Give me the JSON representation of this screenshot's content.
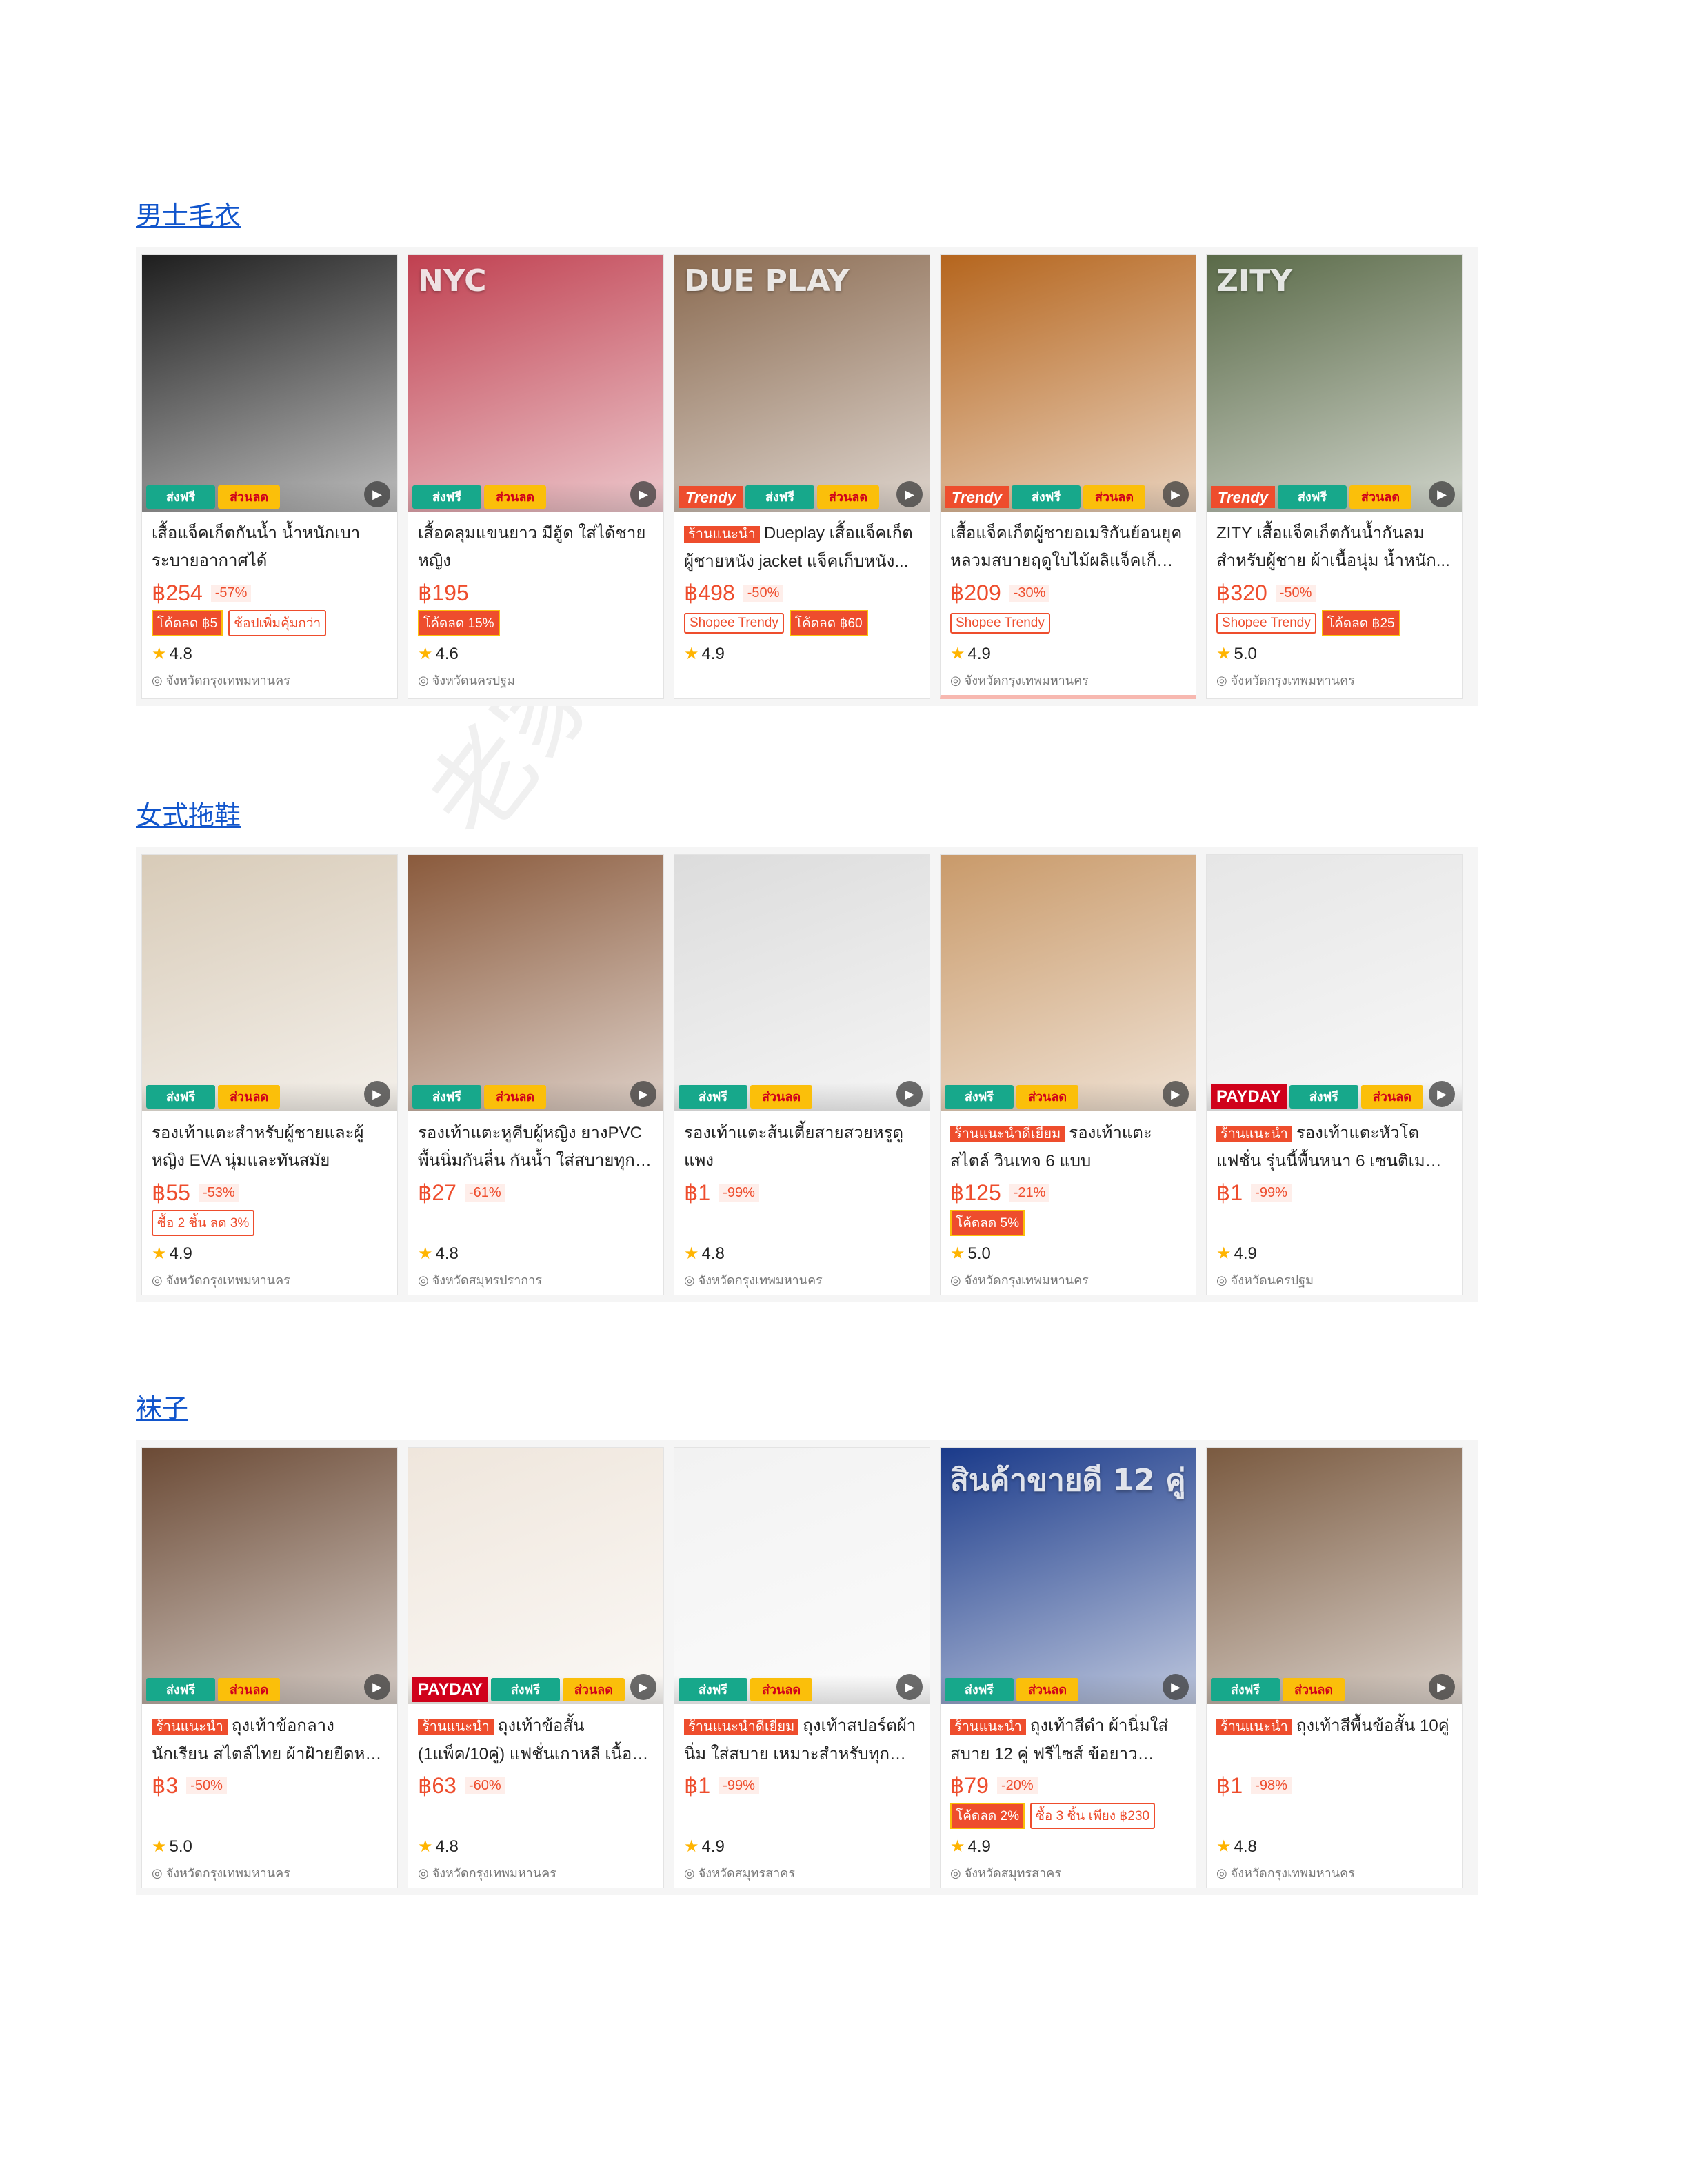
{
  "watermark": "老家出品",
  "sections": [
    {
      "title": "男士毛衣",
      "products": [
        {
          "image_text": "",
          "image_bg": "#1e1e1e",
          "top_badge": "",
          "title_tag": "",
          "title": "เสื้อแจ็คเก็ตกันน้ำ น้ำหนักเบา ระบายอากาศได้",
          "price": "฿254",
          "discount": "-57%",
          "promos": [
            {
              "text": "โค้ดลด ฿5",
              "style": "fill"
            },
            {
              "text": "ช้อปเพิ่มคุ้มกว่า",
              "style": "out"
            }
          ],
          "rating": "4.8",
          "location": "จังหวัดกรุงเทพมหานคร"
        },
        {
          "image_text": "NYC",
          "image_bg": "#c04050",
          "top_badge": "",
          "title_tag": "",
          "title": "เสื้อคลุมแขนยาว มีฮู้ด ใส่ได้ชาย หญิง",
          "price": "฿195",
          "discount": "",
          "promos": [
            {
              "text": "โค้ดลด 15%",
              "style": "fill"
            }
          ],
          "rating": "4.6",
          "location": "จังหวัดนครปฐม"
        },
        {
          "image_text": "DUE PLAY",
          "image_bg": "#8a6a50",
          "top_badge": "Trendy",
          "title_tag": "ร้านแนะนำ",
          "title": "Dueplay เสื้อแจ็คเก็ต ผู้ชายหนัง jacket แจ็คเก็บหนัง...",
          "price": "฿498",
          "discount": "-50%",
          "promos": [
            {
              "text": "Shopee Trendy",
              "style": "out"
            },
            {
              "text": "โค้ดลด ฿60",
              "style": "fill"
            }
          ],
          "rating": "4.9",
          "location": ""
        },
        {
          "image_text": "",
          "image_bg": "#b5651d",
          "top_badge": "Trendy",
          "title_tag": "",
          "title": "เสื้อแจ็คเก็ตผู้ชายอเมริกันย้อนยุค หลวมสบายฤดูใบไม้ผลิแจ็คเก็ตกันลม...",
          "price": "฿209",
          "discount": "-30%",
          "promos": [
            {
              "text": "Shopee Trendy",
              "style": "out"
            }
          ],
          "rating": "4.9",
          "location": "จังหวัดกรุงเทพมหานคร"
        },
        {
          "image_text": "ZITY",
          "image_bg": "#5a6a48",
          "top_badge": "Trendy",
          "title_tag": "",
          "title": "ZITY เสื้อแจ็คเก็ตกันน้ำกันลม สำหรับผู้ชาย ผ้าเนื้อนุ่ม น้ำหนัก...",
          "price": "฿320",
          "discount": "-50%",
          "promos": [
            {
              "text": "Shopee Trendy",
              "style": "out"
            },
            {
              "text": "โค้ดลด ฿25",
              "style": "fill"
            }
          ],
          "rating": "5.0",
          "location": "จังหวัดกรุงเทพมหานคร"
        }
      ]
    },
    {
      "title": "女式拖鞋",
      "products": [
        {
          "image_text": "",
          "image_bg": "#d8cbb8",
          "top_badge": "",
          "title_tag": "",
          "title": "รองเท้าแตะสำหรับผู้ชายและผู้หญิง EVA นุ่มและทันสมัย",
          "price": "฿55",
          "discount": "-53%",
          "promos": [
            {
              "text": "ซื้อ 2 ชิ้น ลด 3%",
              "style": "out"
            }
          ],
          "rating": "4.9",
          "location": "จังหวัดกรุงเทพมหานคร"
        },
        {
          "image_text": "",
          "image_bg": "#8a5a3c",
          "top_badge": "",
          "title_tag": "",
          "title": "รองเท้าแตะหูคีบผู้หญิง ยางPVC พื้นนิ่มกันลื่น กันน้ำ ใส่สบายทุกวั...",
          "price": "฿27",
          "discount": "-61%",
          "promos": [],
          "rating": "4.8",
          "location": "จังหวัดสมุทรปราการ"
        },
        {
          "image_text": "",
          "image_bg": "#dcdcdc",
          "top_badge": "",
          "title_tag": "",
          "title": "รองเท้าแตะส้นเตี้ยสายสวยหรูดูแพง",
          "price": "฿1",
          "discount": "-99%",
          "promos": [],
          "rating": "4.8",
          "location": "จังหวัดกรุงเทพมหานคร"
        },
        {
          "image_text": "",
          "image_bg": "#c99a6a",
          "top_badge": "",
          "title_tag": "ร้านแนะนำดีเยี่ยม",
          "title": "รองเท้าแตะสไตล์ วินเทจ 6 แบบ",
          "price": "฿125",
          "discount": "-21%",
          "promos": [
            {
              "text": "โค้ดลด 5%",
              "style": "fill"
            }
          ],
          "rating": "5.0",
          "location": "จังหวัดกรุงเทพมหานคร"
        },
        {
          "image_text": "",
          "image_bg": "#e6e6e6",
          "top_badge": "PAYDAY",
          "title_tag": "ร้านแนะนำ",
          "title": "รองเท้าแตะหัวโตแฟชั่น รุ่นนี้พื้นหนา 6 เซนติเมตร สูงปรี๊ด...",
          "price": "฿1",
          "discount": "-99%",
          "promos": [],
          "rating": "4.9",
          "location": "จังหวัดนครปฐม"
        }
      ]
    },
    {
      "title": "袜子",
      "products": [
        {
          "image_text": "",
          "image_bg": "#6b4a35",
          "top_badge": "",
          "title_tag": "ร้านแนะนำ",
          "title": "ถุงเท้าข้อกลางนักเรียน สไตล์ไทย ผ้าฝ้ายยืดหยุ่น ใส่สบ...",
          "price": "฿3",
          "discount": "-50%",
          "promos": [],
          "rating": "5.0",
          "location": "จังหวัดกรุงเทพมหานคร"
        },
        {
          "image_text": "",
          "image_bg": "#efe6dc",
          "top_badge": "PAYDAY",
          "title_tag": "ร้านแนะนำ",
          "title": "ถุงเท้าข้อสั้น (1แพ็ค/10คู่) แฟชั่นเกาหลี เนื้อผ้...",
          "price": "฿63",
          "discount": "-60%",
          "promos": [],
          "rating": "4.8",
          "location": "จังหวัดกรุงเทพมหานคร"
        },
        {
          "image_text": "",
          "image_bg": "#f2f2f2",
          "top_badge": "",
          "title_tag": "ร้านแนะนำดีเยี่ยม",
          "title": "ถุงเท้าสปอร์ตผ้านิ่ม ใส่สบาย เหมาะสำหรับทุกกิจกรรม",
          "price": "฿1",
          "discount": "-99%",
          "promos": [],
          "rating": "4.9",
          "location": "จังหวัดสมุทรสาคร"
        },
        {
          "image_text": "สินค้าขายดี 12 คู่",
          "image_bg": "#1a3a8a",
          "top_badge": "",
          "title_tag": "ร้านแนะนำ",
          "title": "ถุงเท้าสีดำ ผ้านิ่มใส่ สบาย 12 คู่ ฟรีไซส์ ข้อยาว แพ็ค...",
          "price": "฿79",
          "discount": "-20%",
          "promos": [
            {
              "text": "โค้ดลด 2%",
              "style": "fill"
            },
            {
              "text": "ซื้อ 3 ชิ้น เพียง ฿230",
              "style": "out"
            }
          ],
          "rating": "4.9",
          "location": "จังหวัดสมุทรสาคร"
        },
        {
          "image_text": "",
          "image_bg": "#7a5a40",
          "top_badge": "",
          "title_tag": "ร้านแนะนำ",
          "title": "ถุงเท้าสีพื้นข้อสั้น 10คู่",
          "price": "฿1",
          "discount": "-98%",
          "promos": [],
          "rating": "4.8",
          "location": "จังหวัดกรุงเทพมหานคร"
        }
      ]
    }
  ],
  "badges": {
    "free_ship": "ส่งฟรี",
    "discount": "ส่วนลด"
  }
}
